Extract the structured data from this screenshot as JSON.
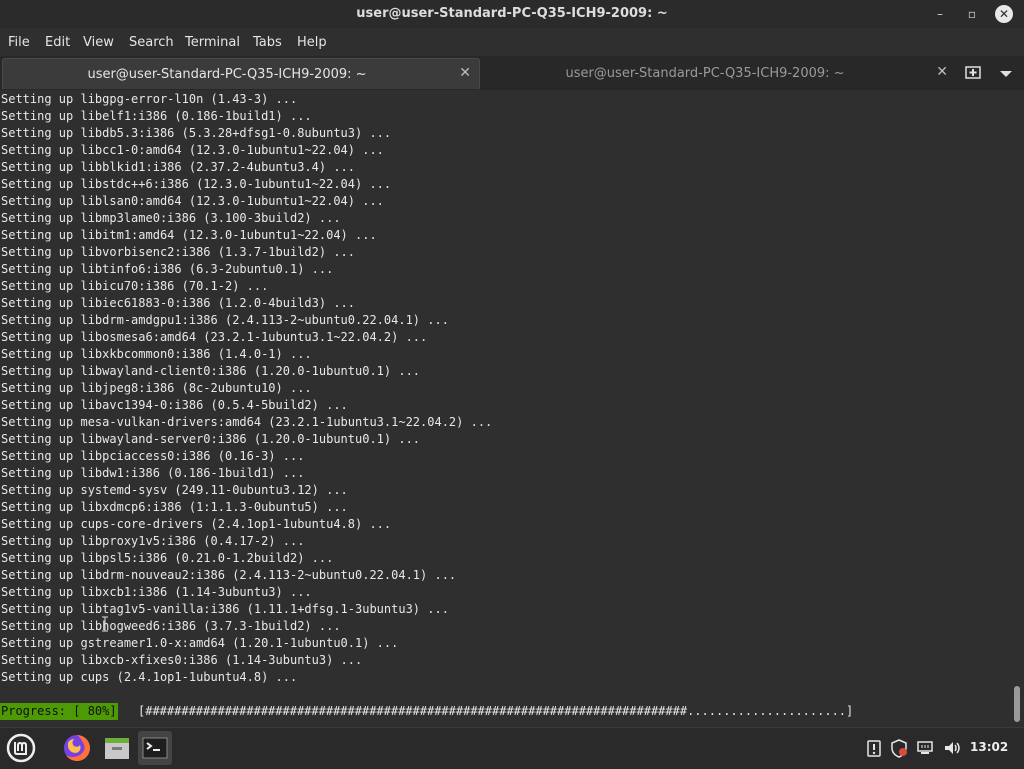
{
  "window": {
    "title": "user@user-Standard-PC-Q35-ICH9-2009: ~",
    "minimize_glyph": "–",
    "maximize_glyph": "▫",
    "close_glyph": "✕"
  },
  "menu": {
    "file": "File",
    "edit": "Edit",
    "view": "View",
    "search": "Search",
    "terminal": "Terminal",
    "tabs": "Tabs",
    "help": "Help"
  },
  "tabs": [
    {
      "label": "user@user-Standard-PC-Q35-ICH9-2009: ~",
      "close": "✕",
      "active": true
    },
    {
      "label": "user@user-Standard-PC-Q35-ICH9-2009: ~",
      "close": "✕",
      "active": false
    }
  ],
  "terminal": {
    "lines": [
      "Setting up libgpg-error-l10n (1.43-3) ...",
      "Setting up libelf1:i386 (0.186-1build1) ...",
      "Setting up libdb5.3:i386 (5.3.28+dfsg1-0.8ubuntu3) ...",
      "Setting up libcc1-0:amd64 (12.3.0-1ubuntu1~22.04) ...",
      "Setting up libblkid1:i386 (2.37.2-4ubuntu3.4) ...",
      "Setting up libstdc++6:i386 (12.3.0-1ubuntu1~22.04) ...",
      "Setting up liblsan0:amd64 (12.3.0-1ubuntu1~22.04) ...",
      "Setting up libmp3lame0:i386 (3.100-3build2) ...",
      "Setting up libitm1:amd64 (12.3.0-1ubuntu1~22.04) ...",
      "Setting up libvorbisenc2:i386 (1.3.7-1build2) ...",
      "Setting up libtinfo6:i386 (6.3-2ubuntu0.1) ...",
      "Setting up libicu70:i386 (70.1-2) ...",
      "Setting up libiec61883-0:i386 (1.2.0-4build3) ...",
      "Setting up libdrm-amdgpu1:i386 (2.4.113-2~ubuntu0.22.04.1) ...",
      "Setting up libosmesa6:amd64 (23.2.1-1ubuntu3.1~22.04.2) ...",
      "Setting up libxkbcommon0:i386 (1.4.0-1) ...",
      "Setting up libwayland-client0:i386 (1.20.0-1ubuntu0.1) ...",
      "Setting up libjpeg8:i386 (8c-2ubuntu10) ...",
      "Setting up libavc1394-0:i386 (0.5.4-5build2) ...",
      "Setting up mesa-vulkan-drivers:amd64 (23.2.1-1ubuntu3.1~22.04.2) ...",
      "Setting up libwayland-server0:i386 (1.20.0-1ubuntu0.1) ...",
      "Setting up libpciaccess0:i386 (0.16-3) ...",
      "Setting up libdw1:i386 (0.186-1build1) ...",
      "Setting up systemd-sysv (249.11-0ubuntu3.12) ...",
      "Setting up libxdmcp6:i386 (1:1.1.3-0ubuntu5) ...",
      "Setting up cups-core-drivers (2.4.1op1-1ubuntu4.8) ...",
      "Setting up libproxy1v5:i386 (0.4.17-2) ...",
      "Setting up libpsl5:i386 (0.21.0-1.2build2) ...",
      "Setting up libdrm-nouveau2:i386 (2.4.113-2~ubuntu0.22.04.1) ...",
      "Setting up libxcb1:i386 (1.14-3ubuntu3) ...",
      "Setting up libtag1v5-vanilla:i386 (1.11.1+dfsg.1-3ubuntu3) ...",
      "Setting up libhogweed6:i386 (3.7.3-1build2) ...",
      "Setting up gstreamer1.0-x:amd64 (1.20.1-1ubuntu0.1) ...",
      "Setting up libxcb-xfixes0:i386 (1.14-3ubuntu3) ...",
      "Setting up cups (2.4.1op1-1ubuntu4.8) ..."
    ],
    "progress_label": "Progress: [ 80%]",
    "progress_bar": "[###########################################################################......................]",
    "progress_fraction": 0.8
  },
  "taskbar": {
    "icons": [
      "mint-menu-icon",
      "firefox-icon",
      "files-icon",
      "terminal-icon"
    ],
    "tray_icons": [
      "update-manager-icon",
      "shield-icon",
      "network-icon",
      "volume-icon"
    ],
    "clock": "13:02"
  },
  "colors": {
    "terminal_bg": "#2f2f2f",
    "terminal_fg": "#e8e8e8",
    "progress_bg": "#4e9a06",
    "titlebar_bg": "#2b2b2b"
  }
}
